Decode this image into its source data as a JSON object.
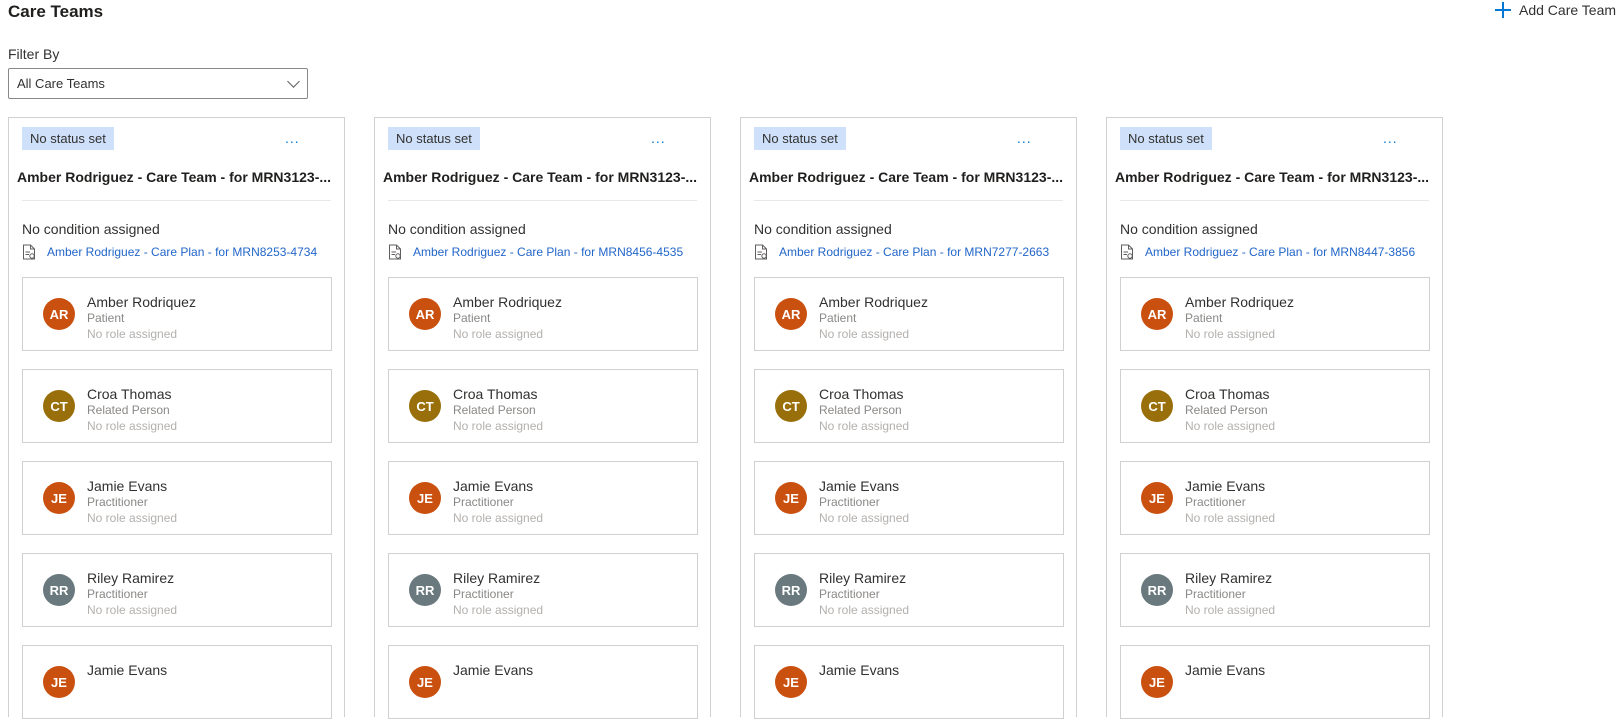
{
  "header": {
    "title": "Care Teams",
    "add_label": "Add Care Team"
  },
  "filter": {
    "label": "Filter By",
    "value": "All Care Teams"
  },
  "colors": {
    "accent": "#0078d4",
    "badge": "#cfe1fa",
    "link": "#2266c9"
  },
  "teams": [
    {
      "status": "No status set",
      "more": "...",
      "title": "Amber Rodriguez - Care Team - for MRN3123-...",
      "condition": "No condition assigned",
      "plan": "Amber Rodriguez - Care Plan - for MRN8253-4734",
      "members": [
        {
          "initials": "AR",
          "name": "Amber Rodriquez",
          "type": "Patient",
          "role": "No role assigned",
          "color": "#ca5010"
        },
        {
          "initials": "CT",
          "name": "Croa Thomas",
          "type": "Related Person",
          "role": "No role assigned",
          "color": "#986f0b"
        },
        {
          "initials": "JE",
          "name": "Jamie Evans",
          "type": "Practitioner",
          "role": "No role assigned",
          "color": "#ca5010"
        },
        {
          "initials": "RR",
          "name": "Riley Ramirez",
          "type": "Practitioner",
          "role": "No role assigned",
          "color": "#69797e"
        },
        {
          "initials": "JE",
          "name": "Jamie Evans",
          "type": "",
          "role": "",
          "color": "#ca5010"
        }
      ]
    },
    {
      "status": "No status set",
      "more": "...",
      "title": "Amber Rodriguez - Care Team - for MRN3123-...",
      "condition": "No condition assigned",
      "plan": "Amber Rodriguez - Care Plan - for MRN8456-4535",
      "members": [
        {
          "initials": "AR",
          "name": "Amber Rodriquez",
          "type": "Patient",
          "role": "No role assigned",
          "color": "#ca5010"
        },
        {
          "initials": "CT",
          "name": "Croa Thomas",
          "type": "Related Person",
          "role": "No role assigned",
          "color": "#986f0b"
        },
        {
          "initials": "JE",
          "name": "Jamie Evans",
          "type": "Practitioner",
          "role": "No role assigned",
          "color": "#ca5010"
        },
        {
          "initials": "RR",
          "name": "Riley Ramirez",
          "type": "Practitioner",
          "role": "No role assigned",
          "color": "#69797e"
        },
        {
          "initials": "JE",
          "name": "Jamie Evans",
          "type": "",
          "role": "",
          "color": "#ca5010"
        }
      ]
    },
    {
      "status": "No status set",
      "more": "...",
      "title": "Amber Rodriguez - Care Team - for MRN3123-...",
      "condition": "No condition assigned",
      "plan": "Amber Rodriguez - Care Plan - for MRN7277-2663",
      "members": [
        {
          "initials": "AR",
          "name": "Amber Rodriquez",
          "type": "Patient",
          "role": "No role assigned",
          "color": "#ca5010"
        },
        {
          "initials": "CT",
          "name": "Croa Thomas",
          "type": "Related Person",
          "role": "No role assigned",
          "color": "#986f0b"
        },
        {
          "initials": "JE",
          "name": "Jamie Evans",
          "type": "Practitioner",
          "role": "No role assigned",
          "color": "#ca5010"
        },
        {
          "initials": "RR",
          "name": "Riley Ramirez",
          "type": "Practitioner",
          "role": "No role assigned",
          "color": "#69797e"
        },
        {
          "initials": "JE",
          "name": "Jamie Evans",
          "type": "",
          "role": "",
          "color": "#ca5010"
        }
      ]
    },
    {
      "status": "No status set",
      "more": "...",
      "title": "Amber Rodriguez - Care Team - for MRN3123-...",
      "condition": "No condition assigned",
      "plan": "Amber Rodriguez - Care Plan - for MRN8447-3856",
      "members": [
        {
          "initials": "AR",
          "name": "Amber Rodriquez",
          "type": "Patient",
          "role": "No role assigned",
          "color": "#ca5010"
        },
        {
          "initials": "CT",
          "name": "Croa Thomas",
          "type": "Related Person",
          "role": "No role assigned",
          "color": "#986f0b"
        },
        {
          "initials": "JE",
          "name": "Jamie Evans",
          "type": "Practitioner",
          "role": "No role assigned",
          "color": "#ca5010"
        },
        {
          "initials": "RR",
          "name": "Riley Ramirez",
          "type": "Practitioner",
          "role": "No role assigned",
          "color": "#69797e"
        },
        {
          "initials": "JE",
          "name": "Jamie Evans",
          "type": "",
          "role": "",
          "color": "#ca5010"
        }
      ]
    }
  ]
}
